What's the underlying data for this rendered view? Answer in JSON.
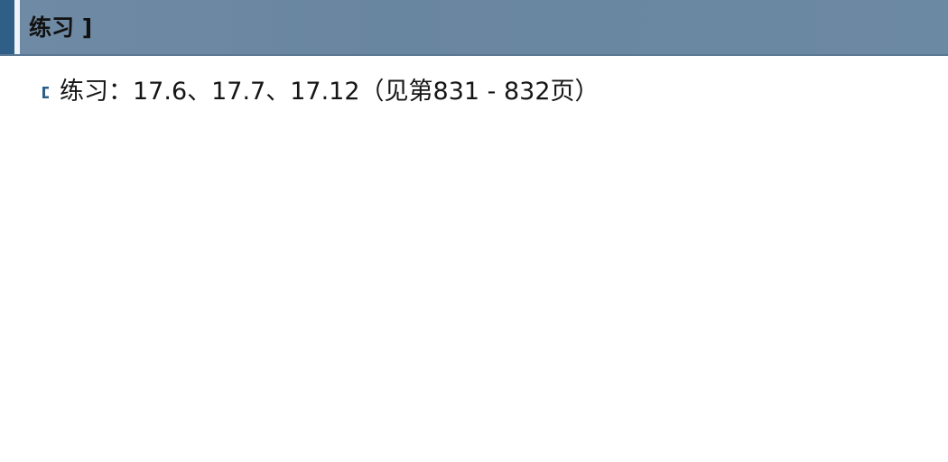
{
  "slide": {
    "title": "练习 ]",
    "bullets": [
      {
        "icon": "bracket-bullet-icon",
        "text": "练习：17.6、17.7、17.12（见第831 - 832页）"
      }
    ]
  },
  "colors": {
    "title_bar": "#6f8aa4",
    "accent_dark": "#2f5f86",
    "bullet_icon": "#2f5f86",
    "text": "#151515"
  }
}
